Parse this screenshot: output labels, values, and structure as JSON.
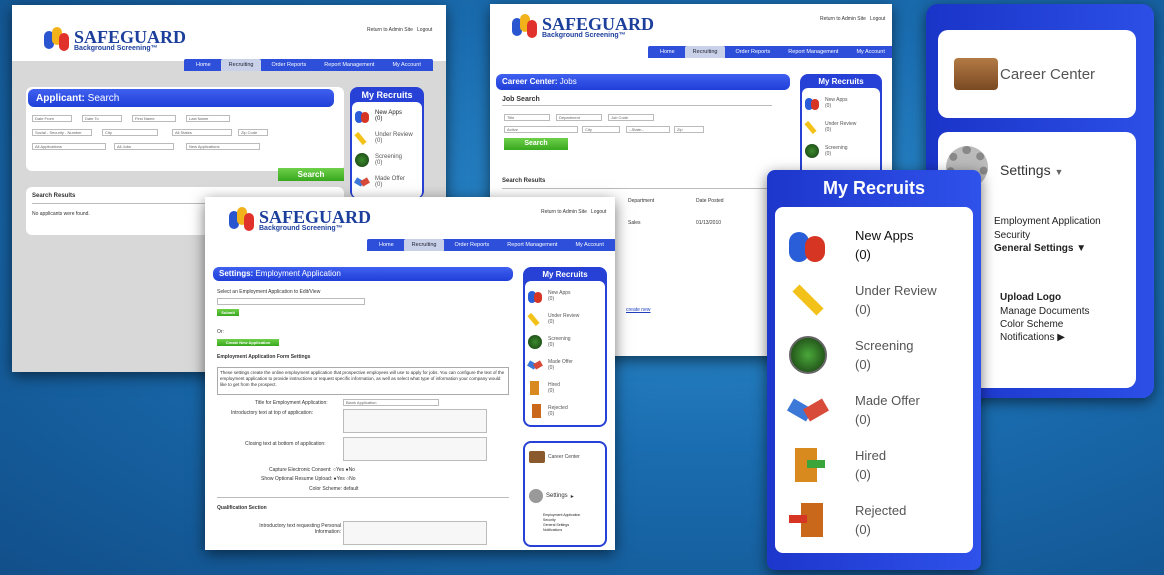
{
  "brand": {
    "name": "SAFEGUARD",
    "tagline": "Background Screening™"
  },
  "header": {
    "return_link": "Return to Admin Site",
    "logout": "Logout"
  },
  "nav": [
    "Home",
    "Recruiting",
    "Order Reports",
    "Report Management",
    "My Account"
  ],
  "shot1": {
    "panel_bold": "Applicant:",
    "panel_title": " Search",
    "fields": [
      "Date From",
      "Date To",
      "First Name",
      "Last Name",
      "Social - Security - Number",
      "City",
      "All States",
      "Zip Code",
      "All Applications",
      "All Jobs",
      "New Applications"
    ],
    "search_btn": "Search",
    "results_title": "Search Results",
    "no_results": "No applicants were found."
  },
  "shot2": {
    "panel_bold": "Career Center:",
    "panel_title": " Jobs",
    "job_search": "Job Search",
    "fields": [
      "Title",
      "Department",
      "Job Code",
      "Active",
      "City",
      "--State--",
      "Zip"
    ],
    "search_btn": "Search",
    "results_title": "Search Results",
    "cols": [
      "Department",
      "Date Posted"
    ],
    "row": [
      "Sales",
      "01/13/2010"
    ],
    "create_new": "create new"
  },
  "shot3": {
    "panel_bold": "Settings:",
    "panel_title": " Employment Application",
    "select_label": "Select an Employment Application to Edit/View",
    "submit": "Submit",
    "or": "Or:",
    "create_btn": "Create New Application",
    "form_settings": "Employment Application Form Settings",
    "desc": "These settings create the online employment application that prospective employees will use to apply for jobs. You can configure the text of the employment application to provide instructions or request specific information, as well as select what type of information your company would like to get from the prospect.",
    "title_label": "Title for Employment Application:",
    "title_value": "Blank Application",
    "intro_label": "Introductory text at top of application:",
    "closing_label": "Closing text at bottom of application:",
    "consent_label": "Capture Electronic Consent:",
    "resume_label": "Show Optional Resume Upload:",
    "yes": "Yes",
    "no": "No",
    "color_label": "Color Scheme:",
    "color_value": "default",
    "qual_section": "Qualification Section",
    "qual_label": "Introductory text requesting Personal Information:"
  },
  "recruits": {
    "title": "My Recruits",
    "items": [
      {
        "label": "New Apps",
        "count": "(0)"
      },
      {
        "label": "Under Review",
        "count": "(0)"
      },
      {
        "label": "Screening",
        "count": "(0)"
      },
      {
        "label": "Made Offer",
        "count": "(0)"
      },
      {
        "label": "Hired",
        "count": "(0)"
      },
      {
        "label": "Rejected",
        "count": "(0)"
      }
    ]
  },
  "settings_panel": {
    "career_center": "Career Center",
    "settings": "Settings",
    "links": [
      "Employment Application",
      "Security",
      "General Settings"
    ],
    "sub_links": [
      "Upload Logo",
      "Manage Documents",
      "Color Scheme",
      "Notifications"
    ]
  },
  "colors": {
    "nav_blue": "#2d4fd9",
    "accent_green": "#38a81e",
    "panel_blue": "#2741d6"
  }
}
